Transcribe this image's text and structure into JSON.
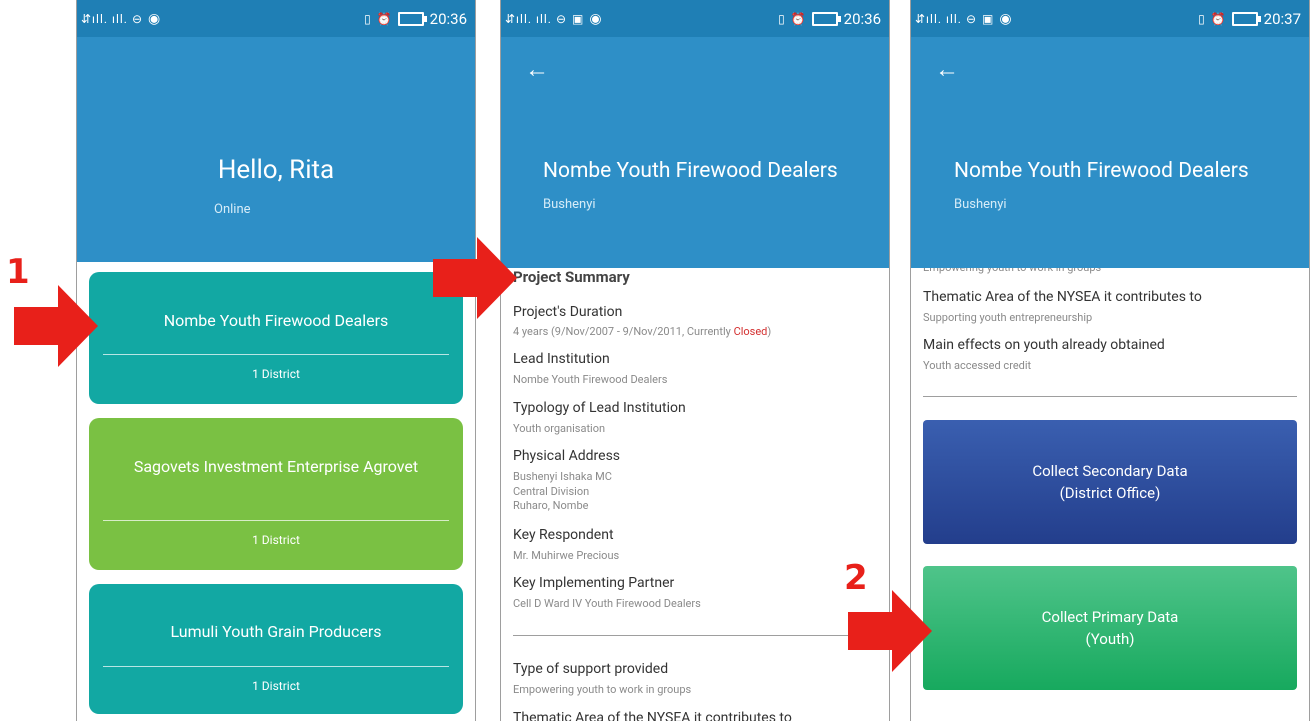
{
  "phone1": {
    "status": {
      "signal": "⇵ıll. ıll. ⊖",
      "wifi": "wifi",
      "time": "20:36"
    },
    "greeting": "Hello, Rita",
    "status_text": "Online",
    "cards": [
      {
        "title": "Nombe Youth Firewood Dealers",
        "district": "1 District",
        "color": "#12a8a3"
      },
      {
        "title": "Sagovets Investment Enterprise Agrovet",
        "district": "1 District",
        "color": "#7ac143"
      },
      {
        "title": "Lumuli Youth Grain Producers",
        "district": "1 District",
        "color": "#12a8a3"
      }
    ]
  },
  "phone2": {
    "status": {
      "time": "20:36"
    },
    "title": "Nombe Youth Firewood Dealers",
    "subtitle": "Bushenyi",
    "section": "Project Summary",
    "fields": [
      {
        "label": "Project's Duration",
        "value": "4 years (9/Nov/2007 - 9/Nov/2011, Currently ",
        "value_status": "Closed",
        "value_end": ")"
      },
      {
        "label": "Lead Institution",
        "value": "Nombe Youth Firewood Dealers"
      },
      {
        "label": "Typology of Lead Institution",
        "value": "Youth organisation"
      },
      {
        "label": "Physical Address",
        "lines": [
          "Bushenyi Ishaka MC",
          "Central Division",
          "Ruharo, Nombe"
        ]
      },
      {
        "label": "Key Respondent",
        "value": "Mr. Muhirwe Precious"
      },
      {
        "label": "Key Implementing Partner",
        "value": "Cell D Ward IV Youth Firewood Dealers"
      },
      {
        "label": "Type of support provided",
        "value": "Empowering youth to work in groups"
      },
      {
        "label": "Thematic Area of the NYSEA it contributes to"
      }
    ]
  },
  "phone3": {
    "status": {
      "time": "20:37"
    },
    "title": "Nombe Youth Firewood Dealers",
    "subtitle": "Bushenyi",
    "clipped_text": "Empowering youth to work in groups",
    "fields": [
      {
        "label": "Thematic Area of the NYSEA it contributes to",
        "value": "Supporting youth entrepreneurship"
      },
      {
        "label": "Main effects on youth already obtained",
        "value": "Youth accessed credit"
      }
    ],
    "buttons": [
      {
        "label_line1": "Collect Secondary Data",
        "label_line2": "(District Office)",
        "color": "#2b4a99"
      },
      {
        "label_line1": "Collect Primary Data",
        "label_line2": "(Youth)",
        "color": "#1db36a"
      }
    ]
  },
  "markers": {
    "one": "1",
    "two": "2"
  },
  "colors": {
    "status_bar": "#1f7fb5",
    "header": "#2e8fc7",
    "arrow": "#e8201a",
    "closed": "#d32f2f"
  }
}
